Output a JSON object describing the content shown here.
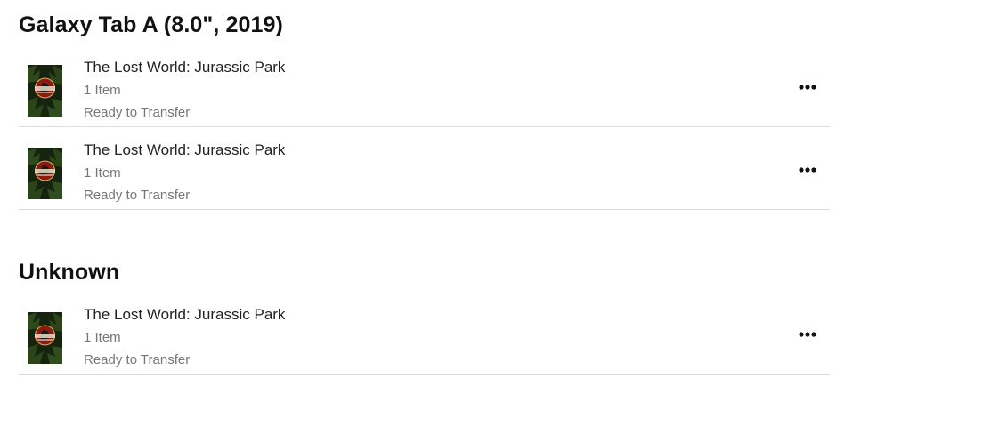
{
  "groups": [
    {
      "title": "Galaxy Tab A (8.0\", 2019)",
      "items": [
        {
          "title": "The Lost World: Jurassic Park",
          "count": "1 Item",
          "status": "Ready to Transfer",
          "thumbnail_icon": "movie-poster-thumbnail",
          "menu_icon": "more-horizontal-icon"
        },
        {
          "title": "The Lost World: Jurassic Park",
          "count": "1 Item",
          "status": "Ready to Transfer",
          "thumbnail_icon": "movie-poster-thumbnail",
          "menu_icon": "more-horizontal-icon"
        }
      ]
    },
    {
      "title": "Unknown",
      "items": [
        {
          "title": "The Lost World: Jurassic Park",
          "count": "1 Item",
          "status": "Ready to Transfer",
          "thumbnail_icon": "movie-poster-thumbnail",
          "menu_icon": "more-horizontal-icon"
        }
      ]
    }
  ],
  "colors": {
    "title_text": "#111111",
    "secondary_text": "#777777",
    "divider": "#dcdcdc",
    "poster_bg": "#1b2a14",
    "poster_logo": "#8b1a12"
  }
}
